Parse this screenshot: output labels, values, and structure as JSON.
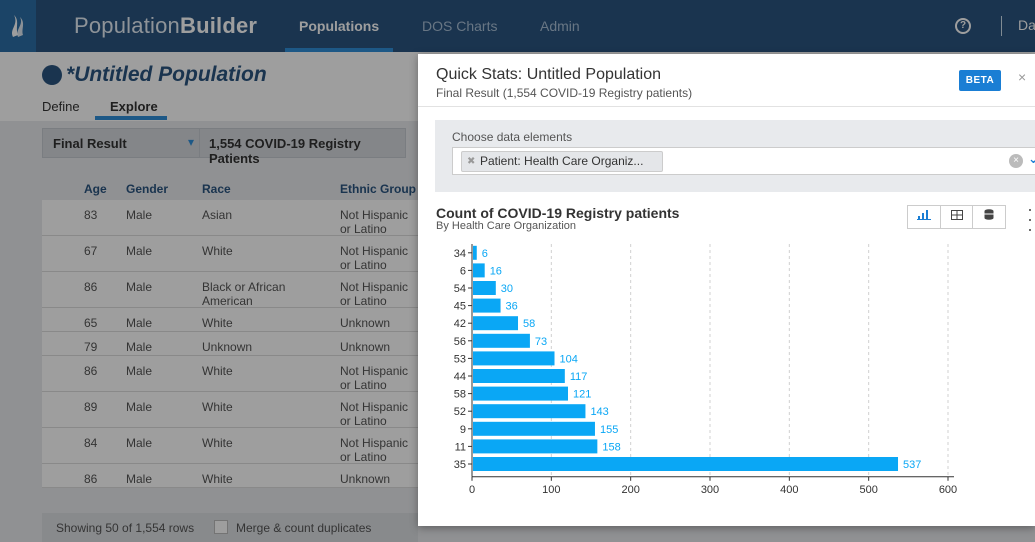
{
  "nav": {
    "brand_light": "Population",
    "brand_bold": "Builder",
    "tabs": [
      "Populations",
      "DOS Charts",
      "Admin"
    ],
    "help_glyph": "?",
    "user_text": "Da",
    "logo_icon": "flame-logo-icon"
  },
  "population": {
    "prefix": "*",
    "title": "Untitled Population",
    "tabs": [
      "Define",
      "Explore"
    ]
  },
  "filter": {
    "selection": "Final Result",
    "count_text": "1,554 COVID-19 Registry Patients"
  },
  "table": {
    "columns": [
      "Age",
      "Gender",
      "Race",
      "Ethnic Group"
    ],
    "rows": [
      [
        "83",
        "Male",
        "Asian",
        "Not Hispanic or Latino"
      ],
      [
        "67",
        "Male",
        "White",
        "Not Hispanic or Latino"
      ],
      [
        "86",
        "Male",
        "Black or African American",
        "Not Hispanic or Latino"
      ],
      [
        "65",
        "Male",
        "White",
        "Unknown"
      ],
      [
        "79",
        "Male",
        "Unknown",
        "Unknown"
      ],
      [
        "86",
        "Male",
        "White",
        "Not Hispanic or Latino"
      ],
      [
        "89",
        "Male",
        "White",
        "Not Hispanic or Latino"
      ],
      [
        "84",
        "Male",
        "White",
        "Not Hispanic or Latino"
      ],
      [
        "86",
        "Male",
        "White",
        "Unknown"
      ]
    ],
    "status": "Showing 50 of 1,554 rows",
    "merge_label": "Merge & count duplicates"
  },
  "modal": {
    "title": "Quick Stats: Untitled Population",
    "subtitle": "Final Result (1,554 COVID-19 Registry patients)",
    "beta": "BETA",
    "close": "×",
    "elements_label": "Choose data elements",
    "chip_text": "Patient: Health Care Organiz...",
    "chart_title": "Count of COVID-19 Registry patients",
    "chart_subtitle": "By Health Care Organization"
  },
  "chart_data": {
    "type": "bar",
    "orientation": "horizontal",
    "categories": [
      "34",
      "6",
      "54",
      "45",
      "42",
      "56",
      "53",
      "44",
      "58",
      "52",
      "9",
      "11",
      "35"
    ],
    "values": [
      6,
      16,
      30,
      36,
      58,
      73,
      104,
      117,
      121,
      143,
      155,
      158,
      537
    ],
    "xlim": [
      0,
      600
    ],
    "xticks": [
      0,
      100,
      200,
      300,
      400,
      500,
      600
    ],
    "grid": true,
    "bar_color": "#0aa7f5"
  }
}
